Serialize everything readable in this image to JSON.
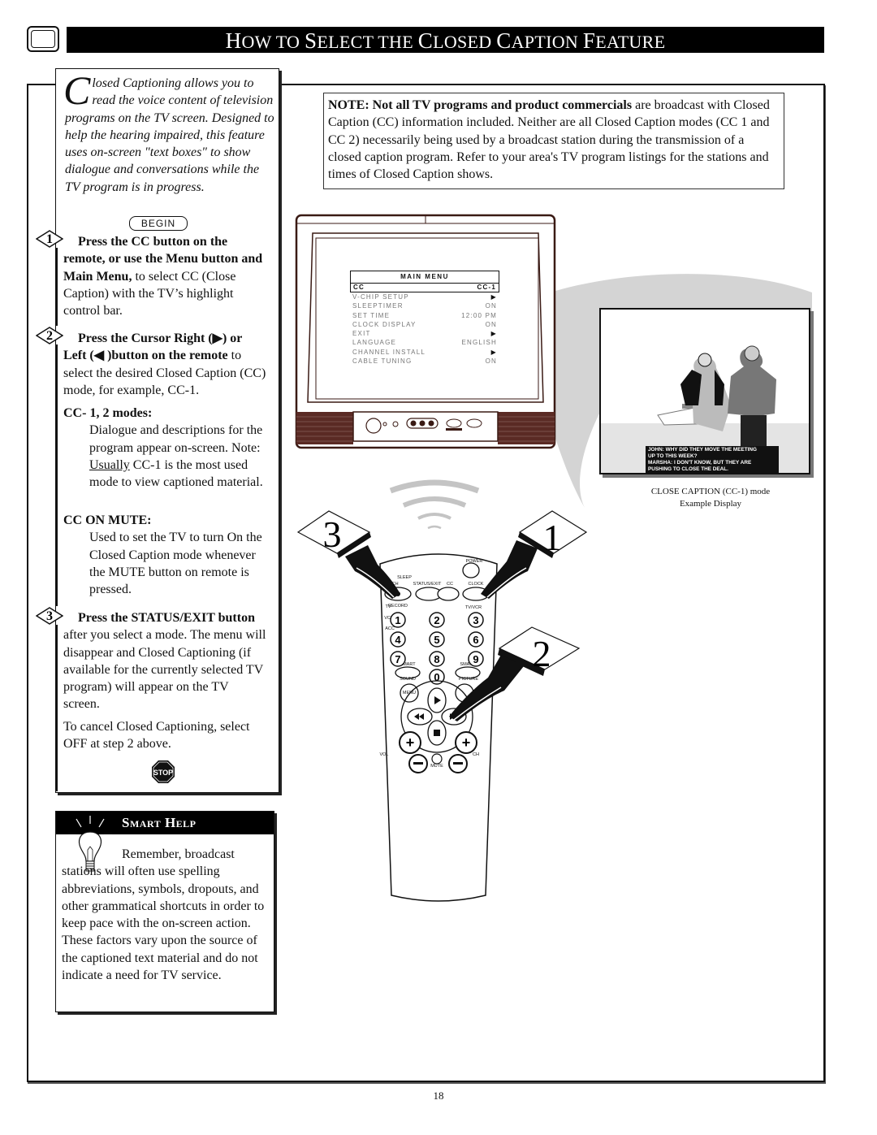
{
  "header": {
    "title_parts": [
      {
        "big": "H",
        "small": "OW TO "
      },
      {
        "big": "S",
        "small": "ELECT THE "
      },
      {
        "big": "C",
        "small": "LOSED "
      },
      {
        "big": "C",
        "small": "APTION "
      },
      {
        "big": "F",
        "small": "EATURE"
      }
    ],
    "title": "How to Select the Closed Caption Feature"
  },
  "intro": {
    "drop_cap": "C",
    "text": "losed Captioning allows you to read the voice content of television programs on the TV screen. Designed to help the hearing impaired, this feature uses on-screen \"text boxes\" to show dialogue and conversations while the TV program is in progress.",
    "begin_label": "BEGIN"
  },
  "steps": [
    {
      "number": "1",
      "bold": "Press the CC button on the remote, or use the Menu button and Main Menu,",
      "rest": " to select CC (Close Caption) with the TV’s highlight control bar."
    },
    {
      "number": "2",
      "bold_a": "Press the Cursor Right (",
      "arrow_right": "▶",
      "bold_b": ") or Left (",
      "arrow_left": "◀",
      "bold_c": " )button on the remote",
      "rest": " to select the desired Closed Caption (CC) mode, for example, CC-1."
    },
    {
      "number": "3",
      "bold": "Press the STATUS/EXIT button",
      "rest": " after you select a mode. The menu will disappear and Closed Captioning (if available for the currently selected TV program) will appear on the TV screen."
    }
  ],
  "modes": {
    "heading": "CC- 1, 2 modes:",
    "text_a": "Dialogue and descriptions for the program appear on-screen. Note: ",
    "underlined": "Usually",
    "text_b": " CC-1 is the most used mode to view captioned material."
  },
  "mute": {
    "heading": "CC ON MUTE:",
    "text": "Used to set the TV to turn On the Closed Caption mode whenever the MUTE button on remote is pressed."
  },
  "cancel_text": "To cancel Closed Captioning, select OFF at step 2 above.",
  "stop_label": "STOP",
  "smart_help": {
    "title": "Smart Help",
    "text": "Remember, broadcast stations will often use spelling abbreviations, symbols, dropouts, and other grammatical shortcuts in order to keep pace with the on-screen action. These factors vary upon the source of the captioned text material and do not indicate a need for TV service."
  },
  "note": {
    "bold": "NOTE: Not all TV programs and product commercials",
    "text": " are broadcast with Closed Caption (CC) information included. Neither are all Closed Caption modes (CC 1 and CC 2) necessarily being used by a broadcast station during the transmission of a closed caption program. Refer to your area's TV program listings for the stations and times of Closed Caption shows."
  },
  "tv_menu": {
    "title": "MAIN MENU",
    "selected": {
      "label": "CC",
      "value": "CC-1"
    },
    "items": [
      {
        "label": "V-CHIP SETUP",
        "value": "▶"
      },
      {
        "label": "SLEEPTIMER",
        "value": "ON"
      },
      {
        "label": "SET TIME",
        "value": "12:00 PM"
      },
      {
        "label": "CLOCK DISPLAY",
        "value": "ON"
      },
      {
        "label": "EXIT",
        "value": "▶"
      },
      {
        "label": "LANGUAGE",
        "value": "ENGLISH"
      },
      {
        "label": "CHANNEL INSTALL",
        "value": "▶"
      },
      {
        "label": "CABLE TUNING",
        "value": "ON"
      }
    ]
  },
  "example": {
    "caption_lines": [
      "JOHN: WHY DID THEY MOVE THE MEETING",
      "UP TO THIS WEEK?",
      "MARSHA: I DON'T KNOW, BUT THEY ARE",
      "PUSHING TO CLOSE THE DEAL."
    ],
    "label_line1": "CLOSE CAPTION (CC-1) mode",
    "label_line2": "Example Display"
  },
  "remote": {
    "step_cards": [
      "3",
      "1",
      "2"
    ],
    "labels": {
      "power": "POWER",
      "sleep": "SLEEP",
      "ach": "A/CH",
      "status_exit": "STATUS/EXIT",
      "cc": "CC",
      "clock": "CLOCK",
      "record": "RECORD",
      "tv_vcr": "TV/VCR",
      "tv": "TV",
      "vcr": "VCR",
      "acc": "ACC",
      "smart_sound": "SMART",
      "sound": "SOUND",
      "smart_picture": "SMART",
      "picture": "PICTURE",
      "menu": "MENU",
      "vol": "VOL",
      "ch": "CH",
      "mute": "MUTE"
    },
    "digits": [
      "1",
      "2",
      "3",
      "4",
      "5",
      "6",
      "7",
      "8",
      "9",
      "0"
    ]
  },
  "page_number": "18"
}
